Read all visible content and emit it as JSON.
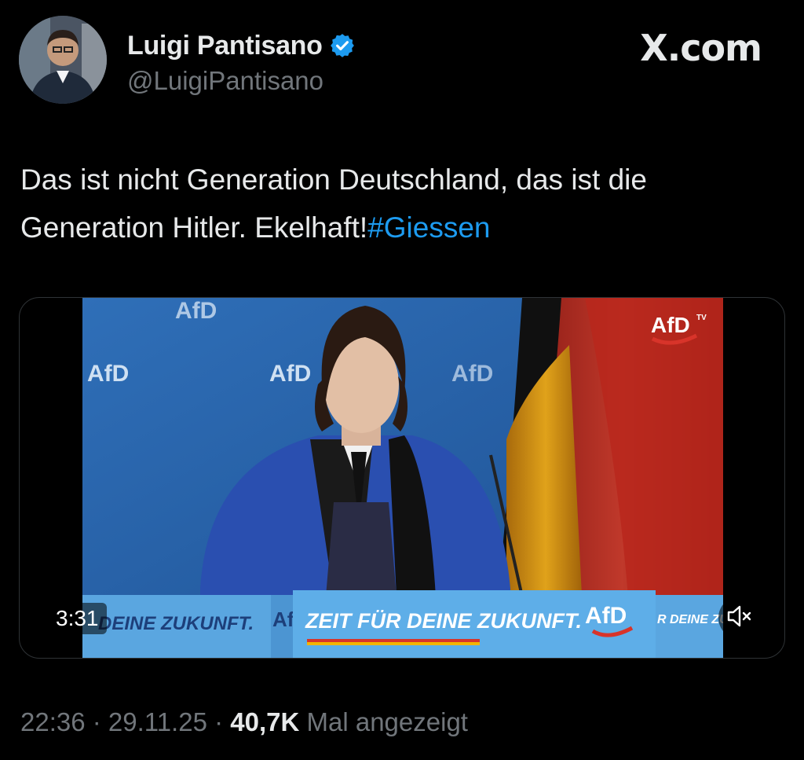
{
  "author": {
    "name": "Luigi Pantisano",
    "handle": "@LuigiPantisano",
    "verified": true
  },
  "site": {
    "brand": "X.com"
  },
  "tweet": {
    "text": "Das ist nicht Generation Deutschland, das ist die Generation Hitler. Ekelhaft!",
    "hashtag": "#Giessen"
  },
  "video": {
    "duration": "3:31",
    "overlay_text": {
      "channel_logo": "AfD",
      "channel_logo_tv": "TV",
      "backdrop_logo": "AfD",
      "podium_slogan": "ZEIT FÜR DEINE ZUKUNFT.",
      "left_slogan": "DEINE ZUKUNFT.",
      "right_slogan": "R DEINE ZUKUNFT.",
      "podium_logo": "AfD",
      "partial_logo": "Af"
    }
  },
  "meta": {
    "time": "22:36",
    "separator": " · ",
    "date": "29.11.25",
    "views": "40,7K",
    "views_label": "Mal angezeigt"
  },
  "colors": {
    "background": "#000000",
    "text": "#e7e9ea",
    "secondary": "#71767b",
    "link": "#1d9bf0",
    "verified": "#1d9bf0"
  },
  "icons": {
    "verified": "verified-badge-icon",
    "mute": "speaker-muted-icon"
  }
}
